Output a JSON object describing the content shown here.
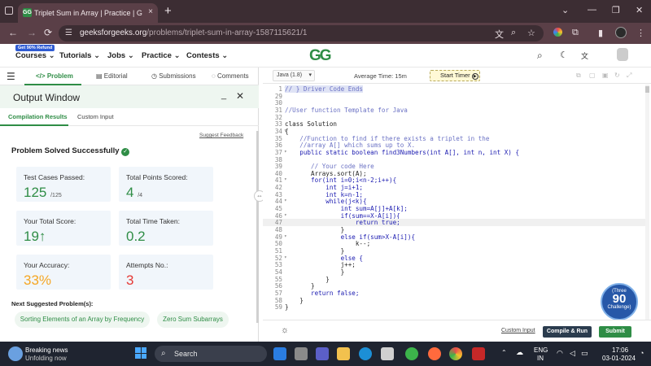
{
  "browser": {
    "tab_title": "Triplet Sum in Array | Practice | G",
    "tab_favicon": "GG",
    "tab_close": "×",
    "new_tab": "+",
    "url_host": "geeksforgeeks.org",
    "url_path": "/problems/triplet-sum-in-array-1587115621/1",
    "window_controls": [
      "⌄",
      "—",
      "❐",
      "✕"
    ]
  },
  "site_nav": {
    "badge": "Get 90% Refund",
    "items": [
      "Courses",
      "Tutorials",
      "Jobs",
      "Practice",
      "Contests"
    ],
    "logo": "GG"
  },
  "problem_tabs": [
    "Problem",
    "Editorial",
    "Submissions",
    "Comments"
  ],
  "output_window": {
    "title": "Output Window",
    "subtabs": [
      "Compilation Results",
      "Custom Input"
    ],
    "suggest_feedback": "Suggest Feedback",
    "status": "Problem Solved Successfully",
    "cards": [
      {
        "label": "Test Cases Passed:",
        "value": "125",
        "suffix": "/125"
      },
      {
        "label": "Total Points Scored:",
        "value": "4",
        "suffix": "/4"
      },
      {
        "label": "Your Total Score:",
        "value": "19",
        "suffix": "↑"
      },
      {
        "label": "Total Time Taken:",
        "value": "0.2",
        "suffix": ""
      },
      {
        "label": "Your Accuracy:",
        "value": "33%",
        "suffix": ""
      },
      {
        "label": "Attempts No.:",
        "value": "3",
        "suffix": ""
      }
    ],
    "next_suggested_label": "Next Suggested Problem(s):",
    "suggestions": [
      "Sorting Elements of an Array by Frequency",
      "Zero Sum Subarrays"
    ]
  },
  "editor": {
    "language": "Java (1.8)",
    "avg_time": "Average Time: 15m",
    "timer_label": "Start Timer",
    "custom_input": "Custom Input",
    "compile_run": "Compile & Run",
    "submit": "Submit",
    "challenge_line1": "(Three",
    "challenge_line2": "90",
    "challenge_line3": "Challenge)",
    "lines": [
      {
        "n": "1",
        "t": "// } Driver Code Ends",
        "k": "cm",
        "fold": true
      },
      {
        "n": "29",
        "t": "",
        "k": ""
      },
      {
        "n": "30",
        "t": "",
        "k": ""
      },
      {
        "n": "31",
        "t": "//User function Template for Java",
        "k": "cm"
      },
      {
        "n": "32",
        "t": "",
        "k": ""
      },
      {
        "n": "33",
        "t": "class Solution",
        "k": ""
      },
      {
        "n": "34",
        "t": "{",
        "k": "",
        "fold": true
      },
      {
        "n": "35",
        "t": "    //Function to find if there exists a triplet in the",
        "k": "cm"
      },
      {
        "n": "36",
        "t": "    //array A[] which sums up to X.",
        "k": "cm"
      },
      {
        "n": "37",
        "t": "    public static boolean find3Numbers(int A[], int n, int X) {",
        "k": "kw",
        "fold": true
      },
      {
        "n": "38",
        "t": "",
        "k": ""
      },
      {
        "n": "39",
        "t": "       // Your code Here",
        "k": "cm"
      },
      {
        "n": "40",
        "t": "       Arrays.sort(A);",
        "k": ""
      },
      {
        "n": "41",
        "t": "       for(int i=0;i<n-2;i++){",
        "k": "kw",
        "fold": true
      },
      {
        "n": "42",
        "t": "           int j=i+1;",
        "k": "kw"
      },
      {
        "n": "43",
        "t": "           int k=n-1;",
        "k": "kw"
      },
      {
        "n": "44",
        "t": "           while(j<k){",
        "k": "kw",
        "fold": true
      },
      {
        "n": "45",
        "t": "               int sum=A[j]+A[k];",
        "k": "kw"
      },
      {
        "n": "46",
        "t": "               if(sum==X-A[i]){",
        "k": "kw",
        "fold": true
      },
      {
        "n": "47",
        "t": "                   return true;",
        "k": "kw",
        "hl": true
      },
      {
        "n": "48",
        "t": "               }",
        "k": ""
      },
      {
        "n": "49",
        "t": "               else if(sum>X-A[i]){",
        "k": "kw",
        "fold": true
      },
      {
        "n": "50",
        "t": "                   k--;",
        "k": ""
      },
      {
        "n": "51",
        "t": "               }",
        "k": ""
      },
      {
        "n": "52",
        "t": "               else {",
        "k": "kw",
        "fold": true
      },
      {
        "n": "53",
        "t": "               j++;",
        "k": ""
      },
      {
        "n": "54",
        "t": "               }",
        "k": ""
      },
      {
        "n": "55",
        "t": "           }",
        "k": ""
      },
      {
        "n": "56",
        "t": "       }",
        "k": ""
      },
      {
        "n": "57",
        "t": "       return false;",
        "k": "kw"
      },
      {
        "n": "58",
        "t": "    }",
        "k": ""
      },
      {
        "n": "59",
        "t": "}",
        "k": ""
      }
    ]
  },
  "taskbar": {
    "news_title": "Breaking news",
    "news_sub": "Unfolding now",
    "search": "Search",
    "lang": "ENG",
    "region": "IN",
    "time": "17:06",
    "date": "03-01-2024"
  },
  "colors": {
    "accent": "#2f8d46",
    "warning": "#f5a623",
    "danger": "#e53935"
  }
}
